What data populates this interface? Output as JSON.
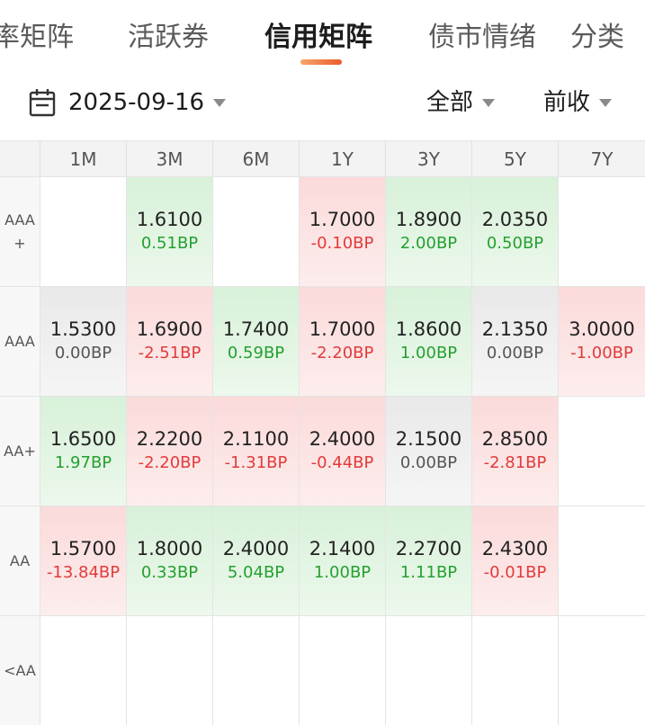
{
  "tabs": [
    "率矩阵",
    "活跃券",
    "信用矩阵",
    "债市情绪",
    "分类"
  ],
  "active_tab": 2,
  "filter": {
    "date": "2025-09-16",
    "scope": "全部",
    "basis": "前收"
  },
  "columns": [
    "1M",
    "3M",
    "6M",
    "1Y",
    "3Y",
    "5Y",
    "7Y"
  ],
  "rows": [
    {
      "label": "AAA+",
      "cells": [
        null,
        {
          "rate": "1.6100",
          "bp": "0.51BP",
          "dir": "down"
        },
        null,
        {
          "rate": "1.7000",
          "bp": "-0.10BP",
          "dir": "up"
        },
        {
          "rate": "1.8900",
          "bp": "2.00BP",
          "dir": "down"
        },
        {
          "rate": "2.0350",
          "bp": "0.50BP",
          "dir": "down"
        },
        null
      ]
    },
    {
      "label": "AAA",
      "cells": [
        {
          "rate": "1.5300",
          "bp": "0.00BP",
          "dir": "flat"
        },
        {
          "rate": "1.6900",
          "bp": "-2.51BP",
          "dir": "up"
        },
        {
          "rate": "1.7400",
          "bp": "0.59BP",
          "dir": "down"
        },
        {
          "rate": "1.7000",
          "bp": "-2.20BP",
          "dir": "up"
        },
        {
          "rate": "1.8600",
          "bp": "1.00BP",
          "dir": "down"
        },
        {
          "rate": "2.1350",
          "bp": "0.00BP",
          "dir": "flat"
        },
        {
          "rate": "3.0000",
          "bp": "-1.00BP",
          "dir": "up"
        }
      ]
    },
    {
      "label": "AA+",
      "cells": [
        {
          "rate": "1.6500",
          "bp": "1.97BP",
          "dir": "down"
        },
        {
          "rate": "2.2200",
          "bp": "-2.20BP",
          "dir": "up"
        },
        {
          "rate": "2.1100",
          "bp": "-1.31BP",
          "dir": "up"
        },
        {
          "rate": "2.4000",
          "bp": "-0.44BP",
          "dir": "up"
        },
        {
          "rate": "2.1500",
          "bp": "0.00BP",
          "dir": "flat"
        },
        {
          "rate": "2.8500",
          "bp": "-2.81BP",
          "dir": "up"
        },
        null
      ]
    },
    {
      "label": "AA",
      "cells": [
        {
          "rate": "1.5700",
          "bp": "-13.84BP",
          "dir": "up"
        },
        {
          "rate": "1.8000",
          "bp": "0.33BP",
          "dir": "down"
        },
        {
          "rate": "2.4000",
          "bp": "5.04BP",
          "dir": "down"
        },
        {
          "rate": "2.1400",
          "bp": "1.00BP",
          "dir": "down"
        },
        {
          "rate": "2.2700",
          "bp": "1.11BP",
          "dir": "down"
        },
        {
          "rate": "2.4300",
          "bp": "-0.01BP",
          "dir": "up"
        },
        null
      ]
    },
    {
      "label": "<AA",
      "cells": [
        null,
        null,
        null,
        null,
        null,
        null,
        null
      ]
    }
  ]
}
